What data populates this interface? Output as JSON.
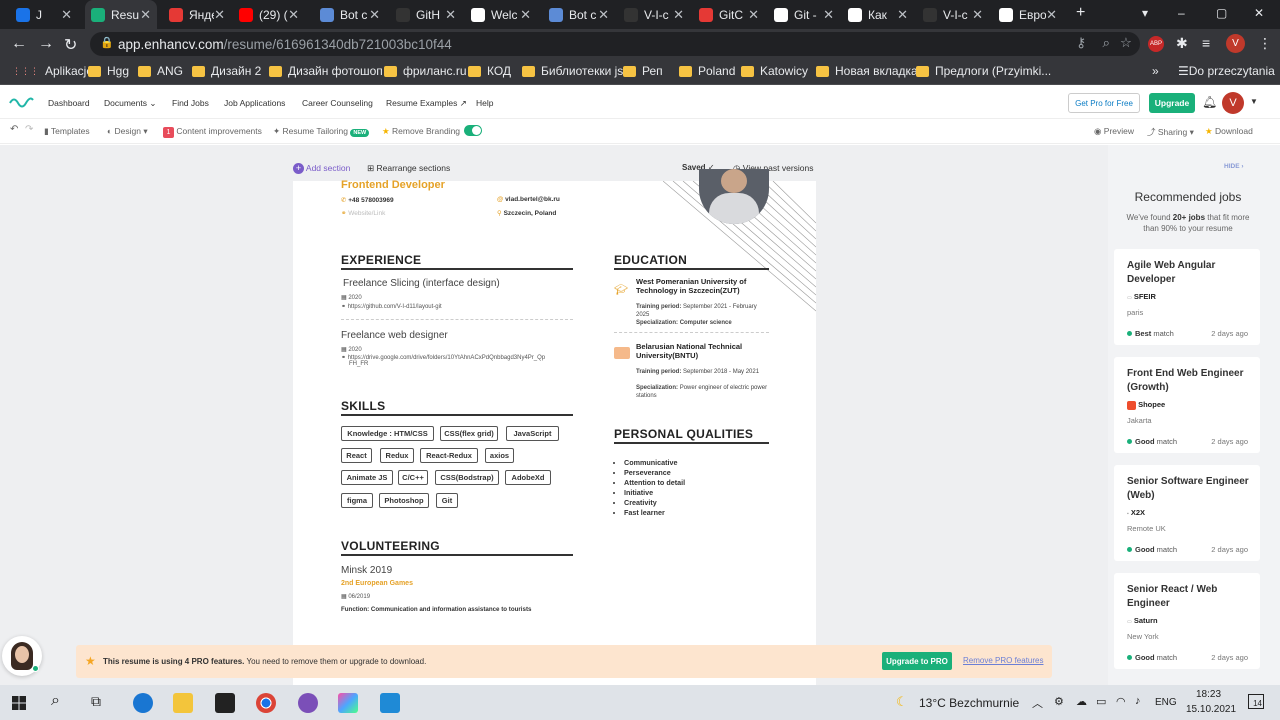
{
  "browser": {
    "tabs": [
      {
        "label": "J",
        "color": "#1a73e8"
      },
      {
        "label": "Resu",
        "color": "#1ab07a"
      },
      {
        "label": "Янде",
        "color": "#e53935"
      },
      {
        "label": "(29) (",
        "color": "#ff0000"
      },
      {
        "label": "Bot c",
        "color": "#5c8bd6"
      },
      {
        "label": "GitH",
        "color": "#333333"
      },
      {
        "label": "Welc",
        "color": "#ffffff"
      },
      {
        "label": "Bot c",
        "color": "#5c8bd6"
      },
      {
        "label": "V-I-c",
        "color": "#333333"
      },
      {
        "label": "GitC",
        "color": "#e53935"
      },
      {
        "label": "Git -",
        "color": "#ffffff"
      },
      {
        "label": "Как",
        "color": "#ffffff"
      },
      {
        "label": "V-I-c",
        "color": "#333333"
      },
      {
        "label": "Евро",
        "color": "#ffffff"
      }
    ],
    "url_host": "app.enhancv.com",
    "url_path": "/resume/616961340db721003bc10f44",
    "profile_initial": "V",
    "bookmarks": [
      "Aplikacje",
      "Hgg",
      "ANG",
      "Дизайн 2",
      "Дизайн фотошоп",
      "фриланс.ru",
      "КОД",
      "Библиотекки js",
      "Реп",
      "Poland",
      "Katowicy",
      "Новая вкладка",
      "Предлоги (Przyimki..."
    ],
    "bookmarks_more": "»",
    "reading_list": "Do przeczytania"
  },
  "appnav": {
    "links": [
      "Dashboard",
      "Documents",
      "Find Jobs",
      "Job Applications",
      "Career Counseling",
      "Resume Examples",
      "Help"
    ],
    "get_pro": "Get Pro for Free",
    "upgrade": "Upgrade",
    "avatar": "V"
  },
  "editor_toolbar": {
    "templates": "Templates",
    "design": "Design",
    "content_count": "1",
    "content": "Content improvements",
    "tailoring": "Resume Tailoring",
    "new_badge": "NEW",
    "remove_branding": "Remove Branding",
    "preview": "Preview",
    "sharing": "Sharing",
    "download": "Download"
  },
  "canvas": {
    "add_section": "Add section",
    "rearrange": "Rearrange sections",
    "saved": "Saved",
    "past_versions": "View past versions"
  },
  "resume": {
    "title": "Frontend Developer",
    "phone": "+48 578003969",
    "website": "Website/Link",
    "email": "vlad.bertel@bk.ru",
    "location": "Szczecin, Poland",
    "experience": {
      "heading": "EXPERIENCE",
      "items": [
        {
          "title": "Freelance Slicing (interface design)",
          "year": "2020",
          "link": "https://github.com/V-I-d11/layout-git"
        },
        {
          "title": "Freelance web designer",
          "year": "2020",
          "link": "https://drive.google.com/drive/folders/10YtAhnACxPdQnbbagd3Ny4Pr_Qp",
          "link2": "FH_FR"
        }
      ]
    },
    "education": {
      "heading": "EDUCATION",
      "items": [
        {
          "school": "West Pomeranian University of Technology in Szczecin(ZUT)",
          "period_label": "Training period:",
          "period": "September 2021 - February 2025",
          "spec_label": "Specialization:",
          "spec": "Computer science"
        },
        {
          "school": "Belarusian National Technical University(BNTU)",
          "period_label": "Training period:",
          "period": "September 2018 - May 2021",
          "spec_label": "Specialization:",
          "spec": "Power engineer of electric power stations"
        }
      ]
    },
    "skills": {
      "heading": "SKILLS",
      "tags": [
        "Knowledge : HTM/CSS",
        "CSS(flex grid)",
        "JavaScript",
        "React",
        "Redux",
        "React-Redux",
        "axios",
        "Animate JS",
        "C/C++",
        "CSS(Bodstrap)",
        "AdobeXd",
        "figma",
        "Photoshop",
        "Git"
      ]
    },
    "qualities": {
      "heading": "PERSONAL QUALITIES",
      "items": [
        "Communicative",
        "Perseverance",
        "Attention to detail",
        "Initiative",
        "Creativity",
        "Fast learner"
      ]
    },
    "volunteering": {
      "heading": "VOLUNTEERING",
      "place": "Minsk 2019",
      "event": "2nd European Games",
      "date": "06/2019",
      "function": "Function: Communication and information assistance to tourists"
    }
  },
  "sidebar": {
    "hide": "HIDE",
    "title": "Recommended jobs",
    "sub_pre": "We've found ",
    "sub_bold": "20+ jobs",
    "sub_post": " that fit more than 90% to your resume",
    "jobs": [
      {
        "title": "Agile Web Angular Developer",
        "company": "SFEIR",
        "location": "paris",
        "match_strength": "Best",
        "match_word": "match",
        "ago": "2 days ago"
      },
      {
        "title": "Front End Web Engineer (Growth)",
        "company": "Shopee",
        "location": "Jakarta",
        "match_strength": "Good",
        "match_word": "match",
        "ago": "2 days ago"
      },
      {
        "title": "Senior Software Engineer (Web)",
        "company": "X2X",
        "location": "Remote UK",
        "match_strength": "Good",
        "match_word": "match",
        "ago": "2 days ago"
      },
      {
        "title": "Senior React / Web Engineer",
        "company": "Saturn",
        "location": "New York",
        "match_strength": "Good",
        "match_word": "match",
        "ago": "2 days ago"
      }
    ]
  },
  "pro_banner": {
    "bold": "This resume is using 4 PRO features.",
    "text": " You need to remove them or upgrade to download.",
    "upgrade": "Upgrade to PRO",
    "remove": "Remove PRO features"
  },
  "taskbar": {
    "weather": "13°C  Bezchmurnie",
    "lang": "ENG",
    "time": "18:23",
    "date": "15.10.2021",
    "notif": "14"
  }
}
